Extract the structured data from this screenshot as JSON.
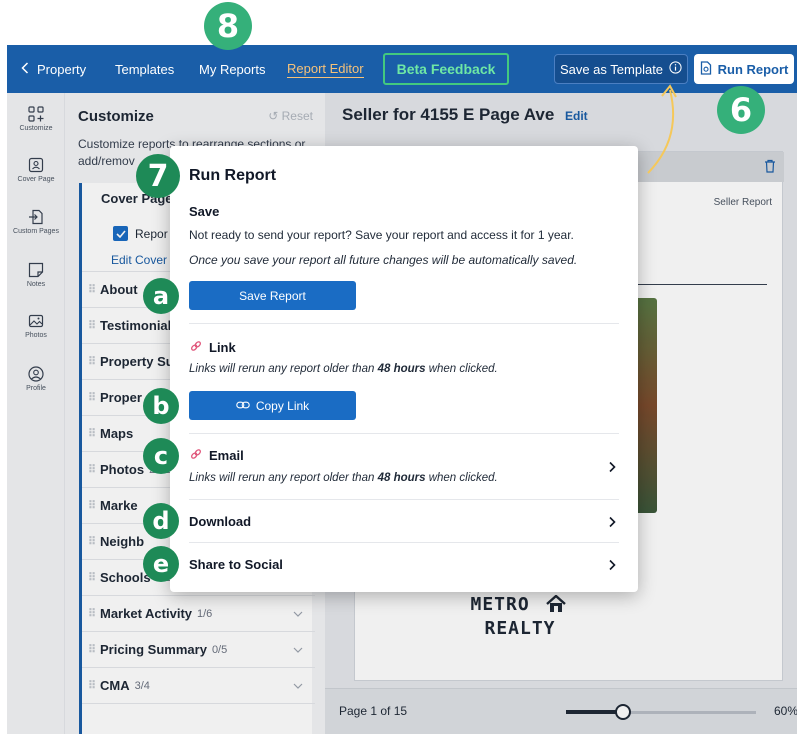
{
  "nav": {
    "back_label": "Property",
    "items": [
      {
        "label": "Templates"
      },
      {
        "label": "My Reports"
      },
      {
        "label": "Report Editor"
      }
    ],
    "beta_label": "Beta Feedback",
    "save_template_label": "Save as Template",
    "run_report_label": "Run Report"
  },
  "rail": {
    "items": [
      {
        "label": "Customize",
        "icon": "customize-icon"
      },
      {
        "label": "Cover Page",
        "icon": "cover-page-icon"
      },
      {
        "label": "Custom Pages",
        "icon": "custom-pages-icon"
      },
      {
        "label": "Notes",
        "icon": "notes-icon"
      },
      {
        "label": "Photos",
        "icon": "photos-icon"
      },
      {
        "label": "Profile",
        "icon": "profile-icon"
      }
    ]
  },
  "panel": {
    "title": "Customize",
    "reset_label": "Reset",
    "description": "Customize reports to rearrange sections or add/remov",
    "cover_page_label": "Cover Page",
    "report_checkbox_label": "Repor",
    "edit_cover_label": "Edit Cover",
    "sections": [
      {
        "label": "About",
        "count": ""
      },
      {
        "label": "Testimonial",
        "count": ""
      },
      {
        "label": "Property Su",
        "count": ""
      },
      {
        "label": "Proper",
        "count": ""
      },
      {
        "label": "Maps",
        "count": ""
      },
      {
        "label": "Photos",
        "count": "24/1"
      },
      {
        "label": "Marke",
        "count": ""
      },
      {
        "label": "Neighb",
        "count": ""
      },
      {
        "label": "Schools",
        "count": "0/1"
      },
      {
        "label": "Market Activity",
        "count": "1/6"
      },
      {
        "label": "Pricing Summary",
        "count": "0/5"
      },
      {
        "label": "CMA",
        "count": "3/4"
      }
    ]
  },
  "main": {
    "report_title": "Seller for 4155 E Page Ave",
    "edit_label": "Edit",
    "seller_report_label": "Seller Report",
    "brand_logo": "METRO",
    "brand_logo_2": "REALTY",
    "page_label": "Page 1 of 15",
    "zoom_value": "60%",
    "zoom_fraction": 0.3
  },
  "modal": {
    "title": "Run Report",
    "save_heading": "Save",
    "save_text_1": "Not ready to send your report? Save your report and access it for 1 year.",
    "save_text_2": "Once you save your report all future changes will be automatically saved.",
    "save_button_label": "Save Report",
    "link_heading": "Link",
    "link_note_pre": "Links will rerun any report older than ",
    "link_note_bold": "48 hours",
    "link_note_post": " when clicked.",
    "copy_link_label": "Copy Link",
    "email_heading": "Email",
    "email_note_pre": "Links will rerun any report older than ",
    "email_note_bold": "48 hours",
    "email_note_post": " when clicked.",
    "download_label": "Download",
    "share_label": "Share to Social"
  },
  "annotations": {
    "badge_a": "a",
    "badge_b": "b",
    "badge_c": "c",
    "badge_d": "d",
    "badge_e": "e",
    "badge_6": "6",
    "badge_7": "7",
    "badge_8": "8"
  },
  "colors": {
    "nav_bg": "#1a5ea8",
    "accent": "#1a6cc4",
    "active_tab": "#f6c27a",
    "badge_green": "#2c9e6b",
    "arrow_yellow": "#f5c85a"
  }
}
